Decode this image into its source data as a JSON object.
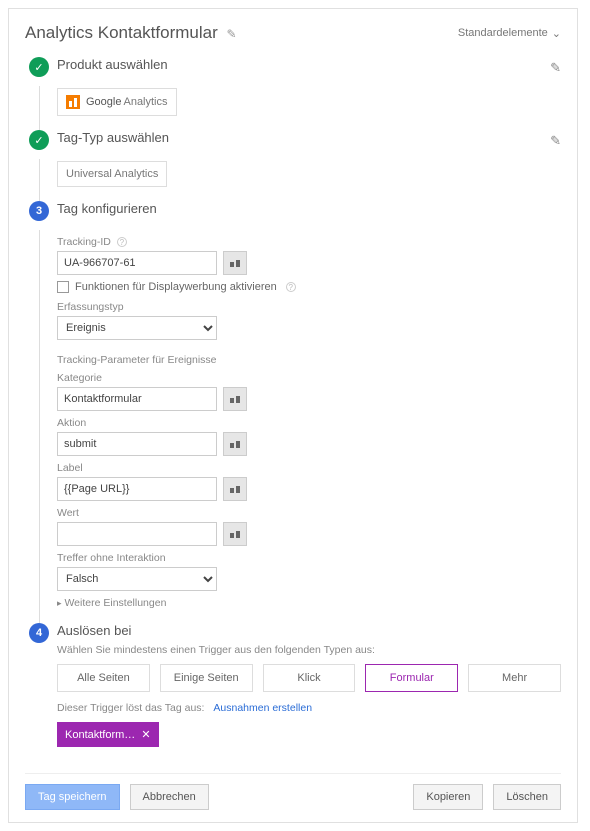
{
  "header": {
    "title": "Analytics Kontaktformular",
    "standard_elements": "Standardelemente"
  },
  "step1": {
    "title": "Produkt auswählen",
    "product_brand": "Google",
    "product_name": "Analytics"
  },
  "step2": {
    "title": "Tag-Typ auswählen",
    "tag_type": "Universal Analytics"
  },
  "step3": {
    "number": "3",
    "title": "Tag konfigurieren",
    "tracking_id_label": "Tracking-ID",
    "tracking_id": "UA-966707-61",
    "display_ads_label": "Funktionen für Displaywerbung aktivieren",
    "track_type_label": "Erfassungstyp",
    "track_type": "Ereignis",
    "tracking_params_header": "Tracking-Parameter für Ereignisse",
    "category_label": "Kategorie",
    "category": "Kontaktformular",
    "action_label": "Aktion",
    "action": "submit",
    "label_label": "Label",
    "label": "{{Page URL}}",
    "value_label": "Wert",
    "value": "",
    "noninteraction_label": "Treffer ohne Interaktion",
    "noninteraction": "Falsch",
    "more_settings": "Weitere Einstellungen"
  },
  "step4": {
    "number": "4",
    "title": "Auslösen bei",
    "hint": "Wählen Sie mindestens einen Trigger aus den folgenden Typen aus:",
    "options": [
      "Alle Seiten",
      "Einige Seiten",
      "Klick",
      "Formular",
      "Mehr"
    ],
    "fires_text": "Dieser Trigger löst das Tag aus:",
    "exceptions_link": "Ausnahmen erstellen",
    "trigger_chip": "Kontaktform…"
  },
  "footer": {
    "save": "Tag speichern",
    "cancel": "Abbrechen",
    "copy": "Kopieren",
    "delete": "Löschen"
  }
}
